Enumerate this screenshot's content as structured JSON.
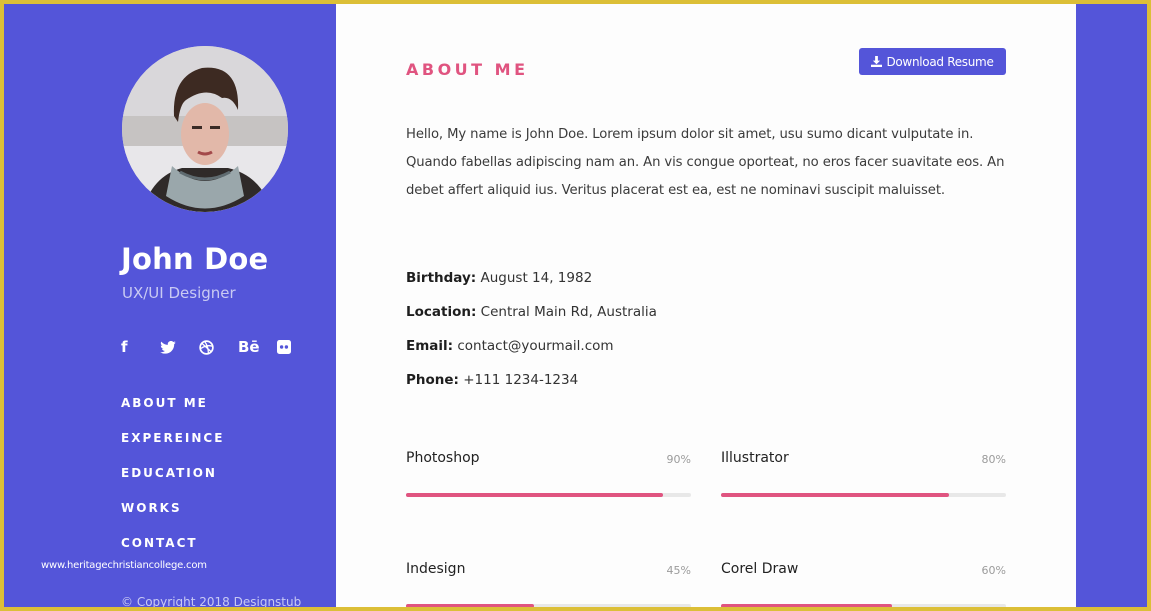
{
  "profile": {
    "name": "John Doe",
    "role": "UX/UI Designer",
    "avatar_alt": "Profile photo of young man with scarf"
  },
  "socials": [
    {
      "icon": "facebook-icon",
      "glyph": "f"
    },
    {
      "icon": "twitter-icon",
      "glyph": ""
    },
    {
      "icon": "dribbble-icon",
      "glyph": ""
    },
    {
      "icon": "behance-icon",
      "glyph": "Bē"
    },
    {
      "icon": "flickr-icon",
      "glyph": ""
    }
  ],
  "nav": {
    "items": [
      {
        "label": "ABOUT ME"
      },
      {
        "label": "EXPEREINCE"
      },
      {
        "label": "EDUCATION"
      },
      {
        "label": "WORKS"
      },
      {
        "label": "CONTACT"
      }
    ]
  },
  "watermark": "www.heritagechristiancollege.com",
  "copyright": "© Copyright 2018 Designstub",
  "about": {
    "title": "ABOUT ME",
    "download_label": "Download Resume",
    "bio": "Hello, My name is John Doe. Lorem ipsum dolor sit amet, usu sumo dicant vulputate in. Quando fabellas adipiscing nam an. An vis congue oporteat, no eros facer suavitate eos. An debet affert aliquid ius. Veritus placerat est ea, est ne nominavi suscipit maluisset.",
    "info": [
      {
        "label": "Birthday:",
        "value": "August 14, 1982"
      },
      {
        "label": "Location:",
        "value": "Central Main Rd, Australia"
      },
      {
        "label": "Email:",
        "value": "contact@yourmail.com"
      },
      {
        "label": "Phone:",
        "value": "+111 1234-1234"
      }
    ]
  },
  "skills": [
    {
      "name": "Photoshop",
      "percent_label": "90%",
      "percent": 90
    },
    {
      "name": "Illustrator",
      "percent_label": "80%",
      "percent": 80
    },
    {
      "name": "Indesign",
      "percent_label": "45%",
      "percent": 45
    },
    {
      "name": "Corel Draw",
      "percent_label": "60%",
      "percent": 60
    }
  ],
  "colors": {
    "brand": "#5455d9",
    "accent": "#e05480",
    "frame": "#dcbf37",
    "track": "#e8e8e8"
  }
}
